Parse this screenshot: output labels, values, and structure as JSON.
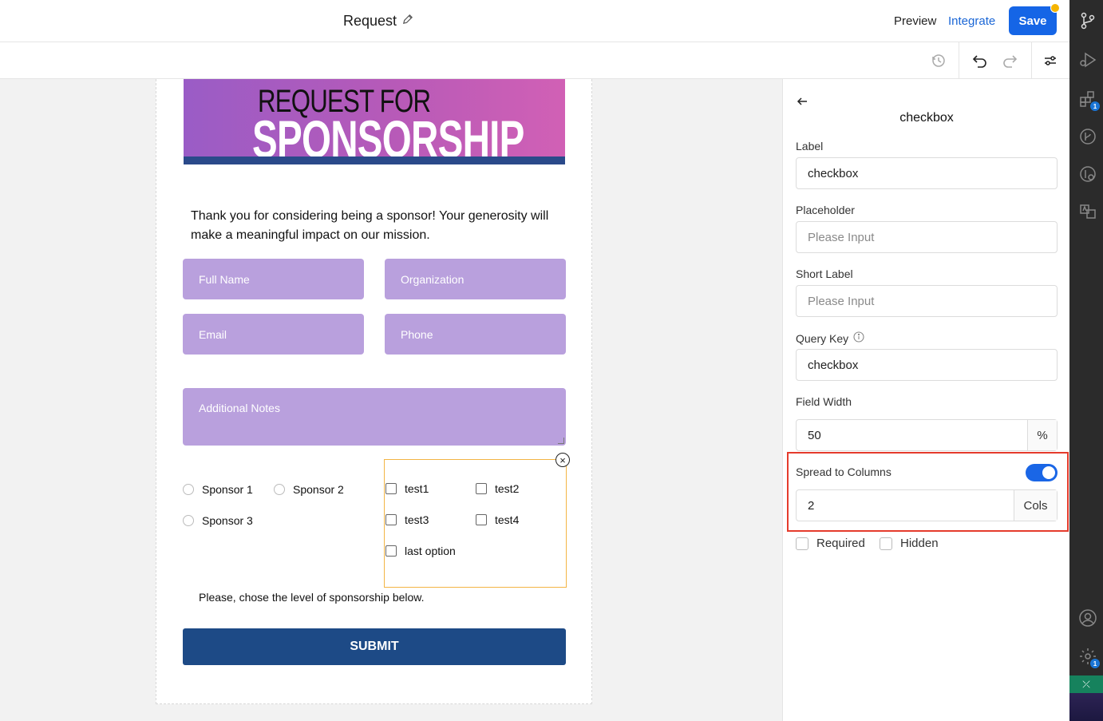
{
  "header": {
    "title": "Request",
    "preview_label": "Preview",
    "integrate_label": "Integrate",
    "save_label": "Save"
  },
  "form": {
    "banner_line1": "REQUEST FOR",
    "banner_line2": "SPONSORSHIP",
    "intro": "Thank you for considering being a sponsor! Your generosity will make a meaningful impact on our mission.",
    "fields": {
      "full_name": "Full Name",
      "organization": "Organization",
      "email": "Email",
      "phone": "Phone",
      "notes": "Additional Notes"
    },
    "radios": [
      "Sponsor 1",
      "Sponsor 2",
      "Sponsor 3"
    ],
    "checkboxes": [
      "test1",
      "test2",
      "test3",
      "test4",
      "last option"
    ],
    "hint": "Please, chose the level of sponsorship below.",
    "submit_label": "SUBMIT"
  },
  "panel": {
    "title": "checkbox",
    "label_label": "Label",
    "label_value": "checkbox",
    "placeholder_label": "Placeholder",
    "placeholder_ph": "Please Input",
    "short_label_label": "Short Label",
    "short_label_ph": "Please Input",
    "query_key_label": "Query Key",
    "query_key_value": "checkbox",
    "field_width_label": "Field Width",
    "field_width_value": "50",
    "field_width_unit": "%",
    "spread_label": "Spread to Columns",
    "spread_enabled": true,
    "cols_value": "2",
    "cols_unit": "Cols",
    "required_label": "Required",
    "hidden_label": "Hidden"
  },
  "activity_bar": {
    "badges": {
      "extensions": "1",
      "settings": "1"
    }
  },
  "colors": {
    "accent": "#1565e6",
    "field_fill": "#b9a0dd",
    "submit": "#1d4a86",
    "highlight": "#e53b2c",
    "selection": "#f3b545"
  }
}
